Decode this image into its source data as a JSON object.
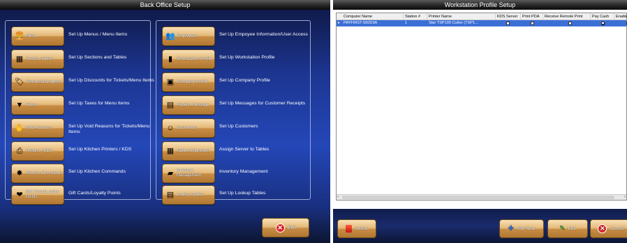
{
  "back_office": {
    "title": "Back Office Setup",
    "left_items": [
      {
        "label": "Menu",
        "desc": "Set Up Menus /  Menu Items",
        "icon": "menu-icon"
      },
      {
        "label": "Section Tables",
        "desc": "Set Up Sections  and  Tables",
        "icon": "table-icon"
      },
      {
        "label": "Discounts/Coupons",
        "desc": "Set Up Discounts for Tickets/Menu Items",
        "icon": "coupon-icon"
      },
      {
        "label": "Taxes",
        "desc": "Set Up Taxes for Menu Items",
        "icon": "tax-icon"
      },
      {
        "label": "Void Reasons",
        "desc": "Set Up Void Reasons for Tickets/Menu Items",
        "icon": "void-icon"
      },
      {
        "label": "Printers / KDS",
        "desc": "Set Up Kitchen Printers / KDS",
        "icon": "printer-icon"
      },
      {
        "label": "Kitchen Commands",
        "desc": "Set Up Kitchen Commands",
        "icon": "kitchen-icon"
      },
      {
        "label": "Gift Cards/Loyalty Points",
        "desc": "Gift Cards/Loyalty Points",
        "icon": "gift-icon"
      }
    ],
    "right_items": [
      {
        "label": "Employees",
        "desc": "Set Up Empoyee Information/User Access",
        "icon": "employees-icon"
      },
      {
        "label": "Workstation Profile",
        "desc": "Set Up Workstation Profile",
        "icon": "workstation-icon"
      },
      {
        "label": "Company Profile",
        "desc": "Set Up Company Profile",
        "icon": "company-icon"
      },
      {
        "label": "Receipt Message",
        "desc": "Set Up Messages for Customer Receipts",
        "icon": "receipt-icon"
      },
      {
        "label": "Customers",
        "desc": "Set Up Customers",
        "icon": "customers-icon"
      },
      {
        "label": "Table Assignment",
        "desc": "Assign Server to Tables",
        "icon": "assignment-icon"
      },
      {
        "label": "Inventory Management",
        "desc": "Inventory Management",
        "icon": "inventory-icon"
      },
      {
        "label": "Lookup Tables",
        "desc": "Set Up Lookup Tables",
        "icon": "lookup-icon"
      }
    ],
    "exit_label": "Exit"
  },
  "workstation": {
    "title": "Workstation Profile Setup",
    "columns": [
      "Computer Name",
      "Station #",
      "Printer Name",
      "KDS Server",
      "Print PDA",
      "Receive Remote Print",
      "Pay Cash",
      "Enable"
    ],
    "row": {
      "computer": "PAYFIRST-560D3A",
      "station": "1",
      "printer": "Star TSP100 Cutter (TSP1...",
      "kds": false,
      "pda": false,
      "remote": false,
      "cash": true
    },
    "buttons": {
      "delete": "Delete",
      "add_new": "Add New",
      "edit": "Edit",
      "cancel": "Cancel"
    }
  }
}
